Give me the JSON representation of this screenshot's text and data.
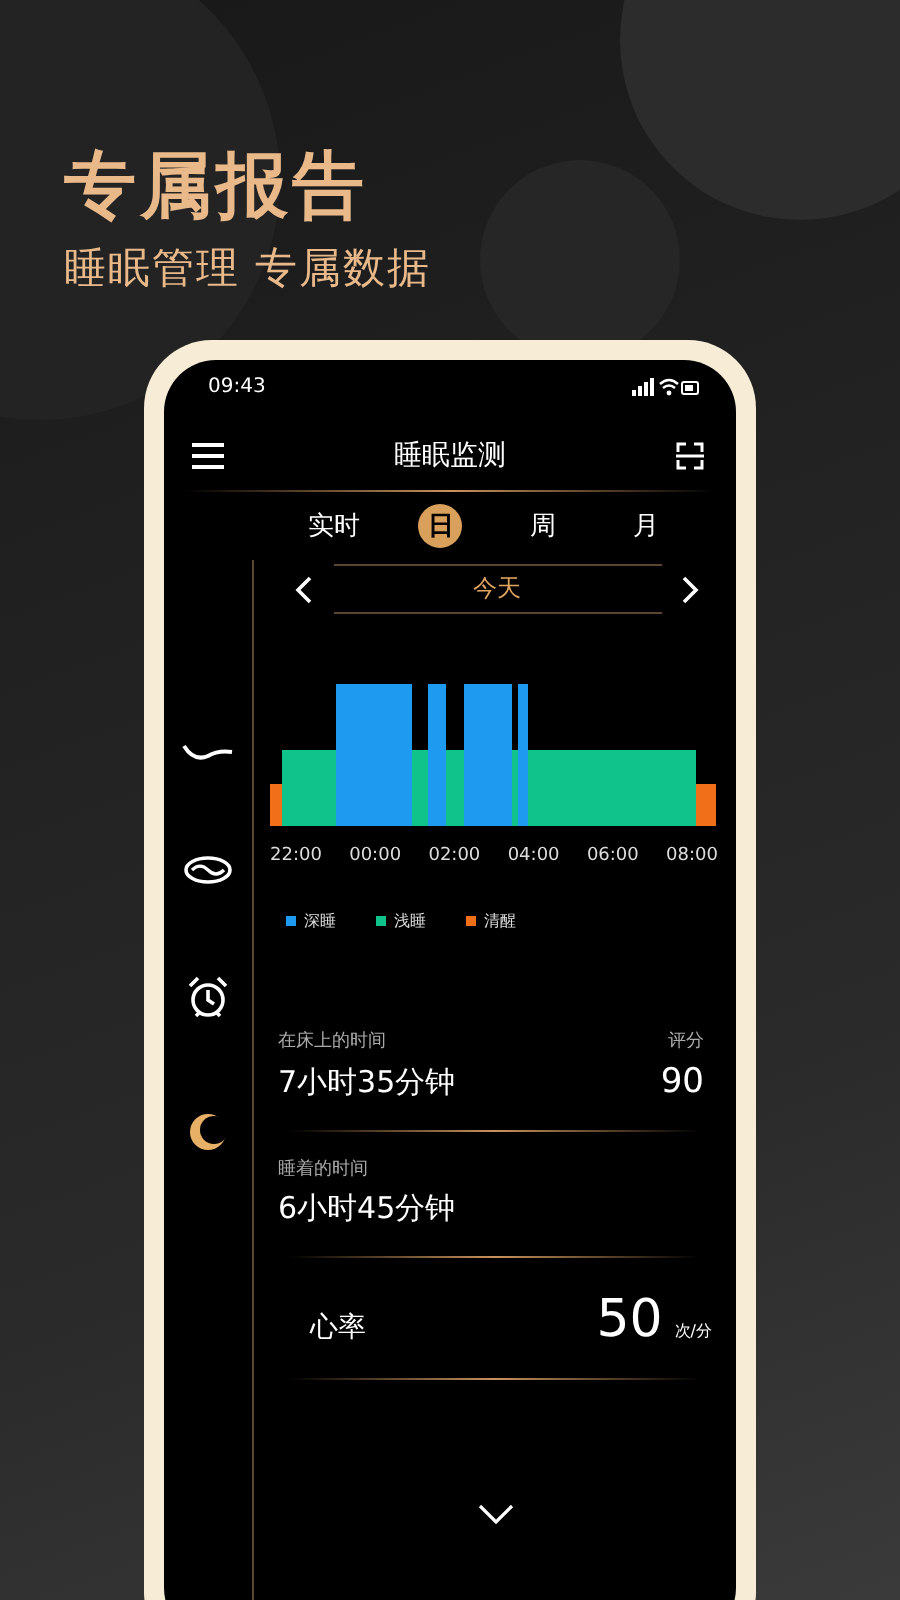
{
  "headline": {
    "title": "专属报告",
    "subtitle": "睡眠管理 专属数据"
  },
  "status_bar": {
    "time": "09:43"
  },
  "header": {
    "title": "睡眠监测"
  },
  "tabs": [
    {
      "label": "实时",
      "selected": false
    },
    {
      "label": "日",
      "selected": true
    },
    {
      "label": "周",
      "selected": false
    },
    {
      "label": "月",
      "selected": false
    }
  ],
  "date_nav": {
    "label": "今天"
  },
  "sidebar": {
    "items": [
      {
        "kind": "wave",
        "selected": false
      },
      {
        "kind": "ring",
        "selected": false
      },
      {
        "kind": "alarm",
        "selected": false
      },
      {
        "kind": "moon",
        "selected": true
      }
    ]
  },
  "chart": {
    "x_labels": [
      "22:00",
      "00:00",
      "02:00",
      "04:00",
      "06:00",
      "08:00"
    ],
    "legend": [
      {
        "label": "深睡",
        "color": "#1e9bf0"
      },
      {
        "label": "浅睡",
        "color": "#10c38a"
      },
      {
        "label": "清醒",
        "color": "#f26f1a"
      }
    ]
  },
  "stats": [
    {
      "kind": "pair",
      "label": "在床上的时间",
      "value": "7小时35分钟",
      "side_label": "评分",
      "side_value": "90"
    },
    {
      "kind": "single",
      "label": "睡着的时间",
      "value": "6小时45分钟"
    },
    {
      "kind": "rate",
      "label": "心率",
      "value": "50",
      "unit": "次/分"
    }
  ]
}
